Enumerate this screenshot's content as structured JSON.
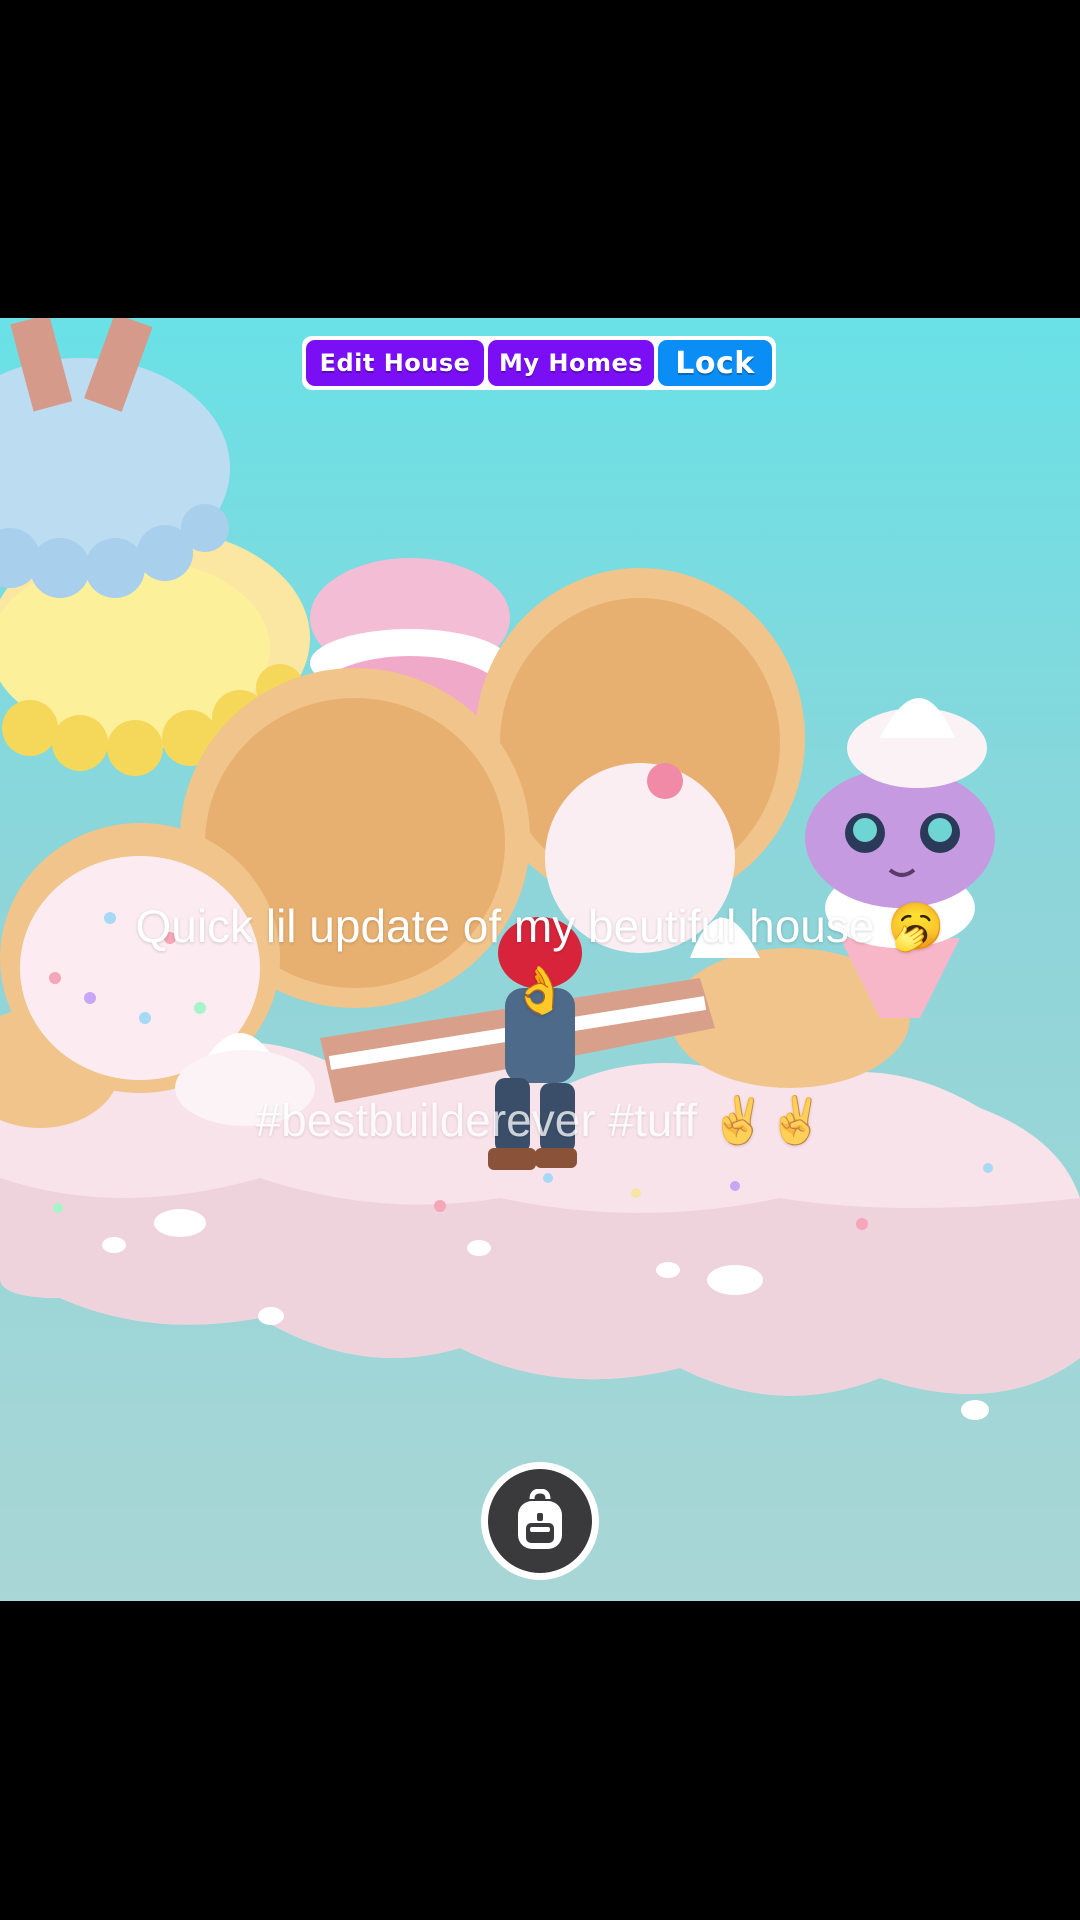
{
  "toolbar": {
    "edit_house_label": "Edit House",
    "my_homes_label": "My Homes",
    "lock_label": "Lock",
    "colors": {
      "purple": "#7a0ef5",
      "blue": "#0a8df5"
    }
  },
  "caption": {
    "line1": "Quick lil update of my beutiful house",
    "line1_emoji": "🥱👌",
    "line2": "#bestbuilderever #tuff",
    "line2_emoji": "✌️✌️"
  },
  "hud": {
    "backpack_icon": "backpack-icon"
  },
  "scene": {
    "sky_color": "#69e1e6",
    "cloud_color": "#fbe9ef"
  }
}
